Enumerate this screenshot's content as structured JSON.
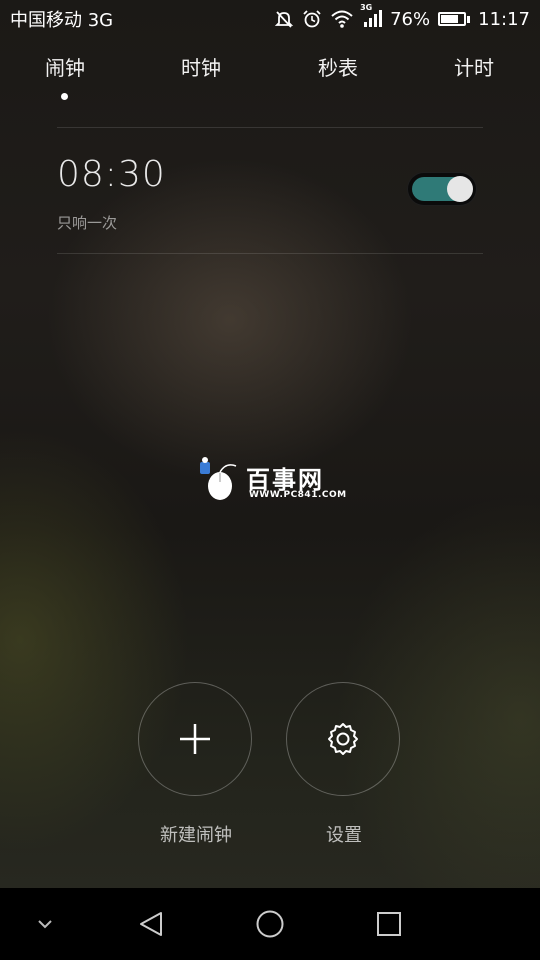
{
  "status_bar": {
    "carrier": "中国移动 3G",
    "network_badge": "3G",
    "battery_percent": "76%",
    "battery_level": 0.76,
    "time": "11:17",
    "icons": [
      "mute-icon",
      "alarm-clock-icon",
      "wifi-icon",
      "signal-icon",
      "battery-icon"
    ]
  },
  "tabs": [
    {
      "label": "闹钟",
      "active": true
    },
    {
      "label": "时钟",
      "active": false
    },
    {
      "label": "秒表",
      "active": false
    },
    {
      "label": "计时",
      "active": false
    }
  ],
  "alarm": {
    "time": "08:30",
    "repeat": "只响一次",
    "enabled": true
  },
  "watermark": {
    "title": "百事网",
    "url": "WWW.PC841.COM"
  },
  "actions": {
    "new_alarm": "新建闹钟",
    "settings": "设置"
  },
  "nav_bar": {
    "icons": [
      "chevron-down-icon",
      "back-icon",
      "home-icon",
      "recents-icon"
    ]
  },
  "colors": {
    "toggle_on": "#2f7a77",
    "text_primary": "#ffffff"
  }
}
